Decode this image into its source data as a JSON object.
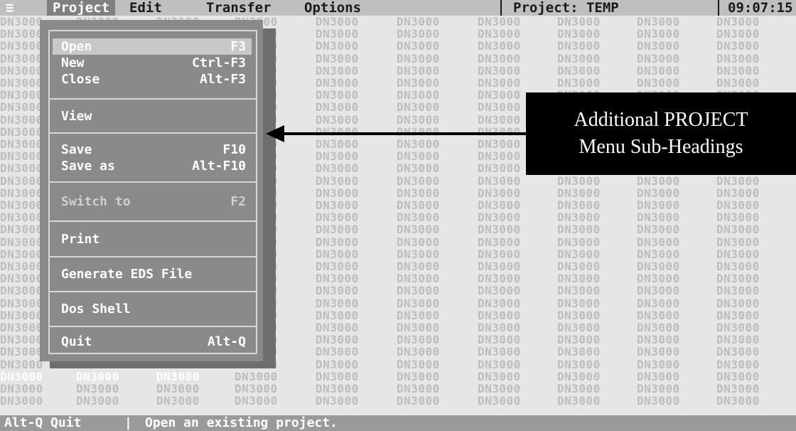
{
  "menubar": {
    "system_icon": "≡",
    "items": [
      "Project",
      "Edit",
      "Transfer",
      "Options"
    ],
    "project_status": "Project: TEMP",
    "clock": "09:07:15"
  },
  "background_cell_text": "DN3000",
  "project_menu": {
    "groups": [
      [
        {
          "label": "Open",
          "key": "F3",
          "highlighted": true
        },
        {
          "label": "New",
          "key": "Ctrl-F3"
        },
        {
          "label": "Close",
          "key": "Alt-F3"
        }
      ],
      [
        {
          "label": "View",
          "key": ""
        }
      ],
      [
        {
          "label": "Save",
          "key": "F10"
        },
        {
          "label": "Save as",
          "key": "Alt-F10"
        }
      ],
      [
        {
          "label": "Switch to",
          "key": "F2",
          "disabled": true
        }
      ],
      [
        {
          "label": "Print",
          "key": ""
        }
      ],
      [
        {
          "label": "Generate EDS File",
          "key": ""
        }
      ],
      [
        {
          "label": "Dos Shell",
          "key": ""
        }
      ],
      [
        {
          "label": "Quit",
          "key": "Alt-Q"
        }
      ]
    ]
  },
  "statusbar": {
    "hint": "Alt-Q Quit",
    "separator": "|",
    "message": "Open an existing project."
  },
  "callout": {
    "line1": "Additional PROJECT",
    "line2": "Menu Sub-Headings"
  }
}
